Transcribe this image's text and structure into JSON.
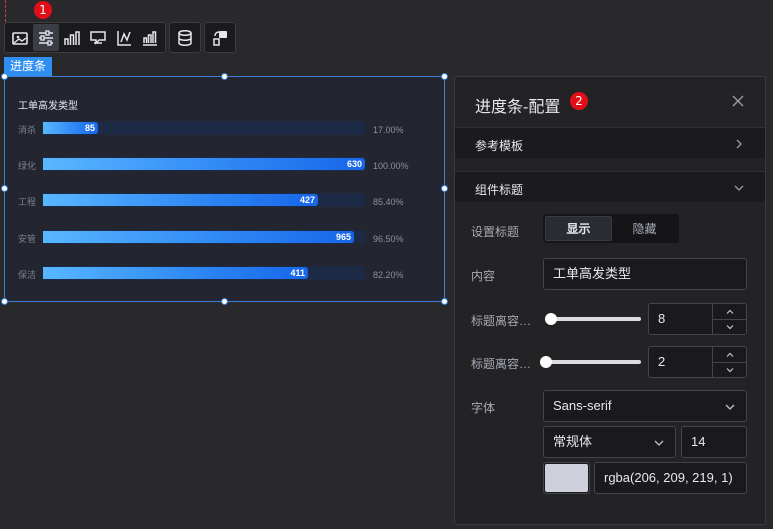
{
  "toolbar": {
    "badge": "1",
    "group1": [
      {
        "icon": "image-icon"
      },
      {
        "icon": "sliders-icon",
        "active": true
      },
      {
        "icon": "bar-chart-icon"
      },
      {
        "icon": "card-icon"
      },
      {
        "icon": "axis-chart-icon"
      },
      {
        "icon": "bar-grid-icon"
      }
    ],
    "group2": [
      {
        "icon": "database-icon"
      }
    ],
    "group3": [
      {
        "icon": "share-link-icon"
      }
    ]
  },
  "widget": {
    "tag": "进度条",
    "title": "工单高发类型",
    "bars": [
      {
        "label": "消杀",
        "value": "85",
        "percent": "17.00%",
        "fill": 0.17
      },
      {
        "label": "绿化",
        "value": "630",
        "percent": "100.00%",
        "fill": 1.0
      },
      {
        "label": "工程",
        "value": "427",
        "percent": "85.40%",
        "fill": 0.854
      },
      {
        "label": "安管",
        "value": "965",
        "percent": "96.50%",
        "fill": 0.965
      },
      {
        "label": "保洁",
        "value": "411",
        "percent": "82.20%",
        "fill": 0.822
      }
    ]
  },
  "panel": {
    "title": "进度条-配置",
    "badge": "2",
    "section_template": "参考模板",
    "section_title": "组件标题",
    "label_show_title": "设置标题",
    "toggle_show": "显示",
    "toggle_hide": "隐藏",
    "label_content": "内容",
    "content_value": "工单高发类型",
    "label_offset1": "标题离容…",
    "offset1_value": "8",
    "offset1_level": 0,
    "label_offset2": "标题离容…",
    "offset2_value": "2",
    "offset2_level": 0,
    "label_font": "字体",
    "font_family": "Sans-serif",
    "font_weight": "常规体",
    "font_size": "14",
    "font_color_text": "rgba(206, 209, 219, 1)",
    "font_color": "#ced1db"
  },
  "colors": {
    "accent": "#2f8ff0",
    "badge": "#e10e1a",
    "bar_start": "#58b7ff",
    "bar_end": "#1766e8",
    "track": "#1d2a45"
  }
}
